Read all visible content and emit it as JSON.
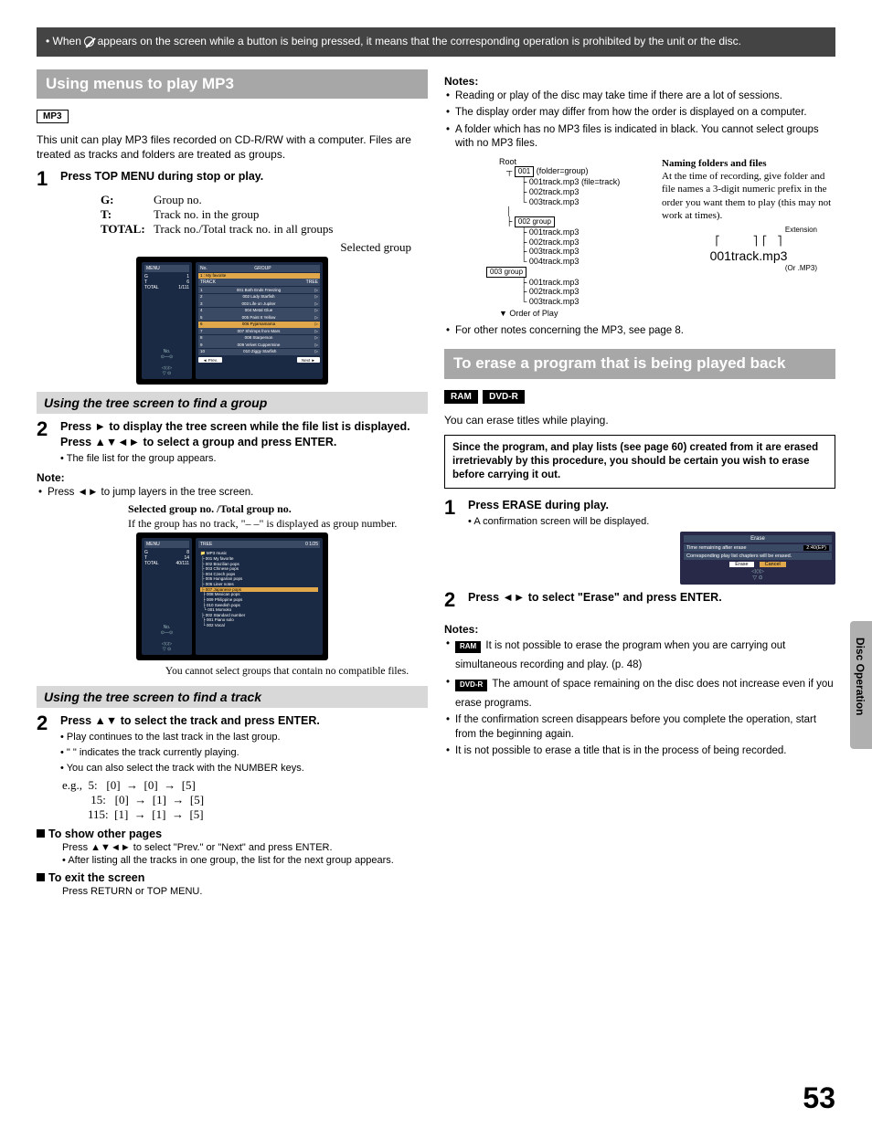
{
  "banner": {
    "pre": "When ",
    "post": " appears on the screen while a button is being pressed, it means that the corresponding operation is prohibited by the unit or the disc."
  },
  "left": {
    "heading": "Using menus to play MP3",
    "mp3_tag": "MP3",
    "intro": "This unit can play MP3 files recorded on CD-R/RW with a computer. Files are treated as tracks and folders are treated as groups.",
    "step1": "Press TOP MENU during stop or play.",
    "defs": {
      "g_k": "G:",
      "g_v": "Group no.",
      "t_k": "T:",
      "t_v": "Track no. in the group",
      "total_k": "TOTAL:",
      "total_v": "Track no./Total track no. in all groups"
    },
    "selected_group": "Selected group",
    "menu1": {
      "menu": "MENU",
      "g": "G",
      "g_v": "1",
      "t": "T",
      "t_v": "6",
      "total": "TOTAL",
      "total_v": "1/111",
      "no_hdr": "No.",
      "group_hdr": "GROUP",
      "track_hdr": "TRACK",
      "tree_hdr": "TREE",
      "group_name": "1 : My favorite",
      "tracks": [
        "001 Both Ends Freezing",
        "002 Lady Starfish",
        "003 Life on Jupiter",
        "004 Metal Glue",
        "005 Paint It Yellow",
        "006 Pyjamamama",
        "007 Shrimps from Mars",
        "008 Starperson",
        "009 Velvet Cuppermine",
        "010 Ziggy Starfish"
      ],
      "prev": "Prev.",
      "next": "Next"
    },
    "sub1": "Using the tree screen to find a group",
    "step2a_pre": "Press ",
    "step2a_mid": " to display the tree screen while the file list is displayed. ",
    "step2a_bold": "Press ▲▼◄► to select a group and press ENTER.",
    "step2a_sub": "The file list for the group appears.",
    "note_hd": "Note:",
    "note1": "Press ◄► to jump layers in the tree screen.",
    "serif1_b": "Selected group no. /Total group no.",
    "serif1": "If the group has no track, \"– –\" is displayed as group number.",
    "menu2": {
      "menu": "MENU",
      "g": "G",
      "g_v": "8",
      "t": "T",
      "t_v": "14",
      "total": "TOTAL",
      "total_v": "40/111",
      "tree_hdr": "TREE",
      "counter": "0   1/25",
      "items": [
        "MP3 music",
        "001 My favorite",
        "002 Brazilian pops",
        "003 Chinese pops",
        "004 Czech pops",
        "005 Hungarian pops",
        "006 Liner notes",
        "007 Japanese pops",
        "008 Mexican pops",
        "009 Philippine pops",
        "010 Swedish pops",
        "001 Momoko",
        "002 Standard number",
        "001 Piano solo",
        "002 Vocal"
      ]
    },
    "serif2": "You cannot select groups that contain no compatible files.",
    "sub2": "Using the tree screen to find a track",
    "step2b": "Press ▲▼ to select the track and press ENTER.",
    "step2b_subs": [
      "Play continues to the last track in the last group.",
      "\"  \" indicates the track currently playing.",
      "You can also select the track with the NUMBER keys."
    ],
    "eg": {
      "label": "e.g.,",
      "r1": "  5:   [0]  →  [0]  →  [5]",
      "r2": " 15:   [0]  →  [1]  →  [5]",
      "r3": "115:  [1]  →  [1]  →  [5]"
    },
    "show_pages_hd": "To show other pages",
    "show_pages_1": "Press ▲▼◄► to select \"Prev.\" or \"Next\" and press ENTER.",
    "show_pages_2": "After listing all the tracks in one group, the list for the next group appears.",
    "exit_hd": "To exit the screen",
    "exit_txt": "Press RETURN or TOP MENU."
  },
  "right": {
    "notes_hd": "Notes:",
    "notes1": [
      "Reading or play of the disc may take time if there are a lot of sessions.",
      "The display order may differ from how the order is displayed on a computer.",
      "A folder which has no MP3 files is indicated in black. You cannot select groups with no MP3 files."
    ],
    "tree": {
      "root": "Root",
      "g001": "001",
      "g001_note": "(folder=group)",
      "f_note": "(file=track)",
      "files1": [
        "001track.mp3",
        "002track.mp3",
        "003track.mp3"
      ],
      "g002": "002 group",
      "files2": [
        "001track.mp3",
        "002track.mp3",
        "003track.mp3",
        "004track.mp3"
      ],
      "g003": "003 group",
      "files3": [
        "001track.mp3",
        "002track.mp3",
        "003track.mp3"
      ],
      "order": "Order of Play"
    },
    "naming": {
      "hd": "Naming folders and files",
      "body": "At the time of recording, give folder and file names a 3-digit numeric prefix in the order you want them to play (this may not work at times).",
      "ext_label": "Extension",
      "example": "001track.mp3",
      "or": "(Or .MP3)"
    },
    "other_notes": "For other notes concerning the MP3, see page 8.",
    "erase_heading": "To erase a program that is being played back",
    "ram_tag": "RAM",
    "dvdr_tag": "DVD-R",
    "erase_intro": "You can erase titles while playing.",
    "warn": "Since the program, and play lists (see page 60) created from it are erased irretrievably by this procedure, you should be certain you wish to erase before carrying it out.",
    "estep1": "Press ERASE during play.",
    "estep1_sub": "A confirmation screen will be displayed.",
    "dialog": {
      "title": "Erase",
      "line1": "Time remaining after erase",
      "val1": "2:40(EP)",
      "line2": "Corresponding play list chapters will be erased.",
      "erase_btn": "Erase",
      "cancel_btn": "Cancel"
    },
    "estep2": "Press ◄► to select \"Erase\" and press ENTER.",
    "notes2_hd": "Notes:",
    "notes2": [
      {
        "tag": "RAM",
        "text": "It is not possible to erase the program when you are carrying out simultaneous recording and play. (p. 48)"
      },
      {
        "tag": "DVD-R",
        "text": "The amount of space remaining on the disc does not increase even if you erase programs."
      },
      {
        "tag": "",
        "text": "If the confirmation screen disappears before you complete the operation, start from the beginning again."
      },
      {
        "tag": "",
        "text": "It is not possible to erase a title that is in the process of being recorded."
      }
    ]
  },
  "sidetab": "Disc Operation",
  "page": "53"
}
